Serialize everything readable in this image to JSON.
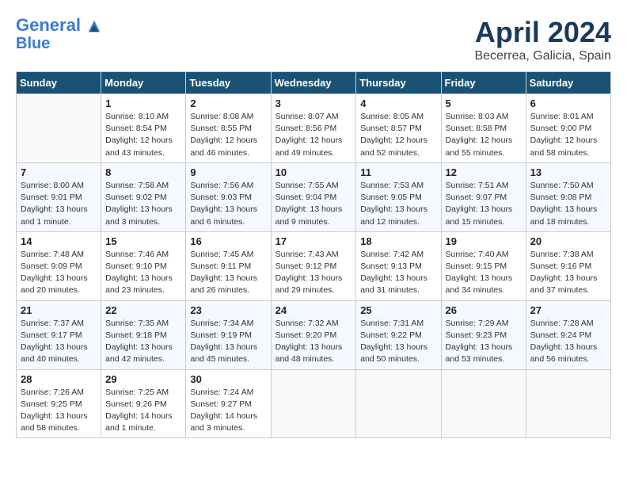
{
  "header": {
    "logo_line1": "General",
    "logo_line2": "Blue",
    "month_title": "April 2024",
    "location": "Becerrea, Galicia, Spain"
  },
  "days_of_week": [
    "Sunday",
    "Monday",
    "Tuesday",
    "Wednesday",
    "Thursday",
    "Friday",
    "Saturday"
  ],
  "weeks": [
    [
      {
        "date": "",
        "sunrise": "",
        "sunset": "",
        "daylight": ""
      },
      {
        "date": "1",
        "sunrise": "Sunrise: 8:10 AM",
        "sunset": "Sunset: 8:54 PM",
        "daylight": "Daylight: 12 hours and 43 minutes."
      },
      {
        "date": "2",
        "sunrise": "Sunrise: 8:08 AM",
        "sunset": "Sunset: 8:55 PM",
        "daylight": "Daylight: 12 hours and 46 minutes."
      },
      {
        "date": "3",
        "sunrise": "Sunrise: 8:07 AM",
        "sunset": "Sunset: 8:56 PM",
        "daylight": "Daylight: 12 hours and 49 minutes."
      },
      {
        "date": "4",
        "sunrise": "Sunrise: 8:05 AM",
        "sunset": "Sunset: 8:57 PM",
        "daylight": "Daylight: 12 hours and 52 minutes."
      },
      {
        "date": "5",
        "sunrise": "Sunrise: 8:03 AM",
        "sunset": "Sunset: 8:58 PM",
        "daylight": "Daylight: 12 hours and 55 minutes."
      },
      {
        "date": "6",
        "sunrise": "Sunrise: 8:01 AM",
        "sunset": "Sunset: 9:00 PM",
        "daylight": "Daylight: 12 hours and 58 minutes."
      }
    ],
    [
      {
        "date": "7",
        "sunrise": "Sunrise: 8:00 AM",
        "sunset": "Sunset: 9:01 PM",
        "daylight": "Daylight: 13 hours and 1 minute."
      },
      {
        "date": "8",
        "sunrise": "Sunrise: 7:58 AM",
        "sunset": "Sunset: 9:02 PM",
        "daylight": "Daylight: 13 hours and 3 minutes."
      },
      {
        "date": "9",
        "sunrise": "Sunrise: 7:56 AM",
        "sunset": "Sunset: 9:03 PM",
        "daylight": "Daylight: 13 hours and 6 minutes."
      },
      {
        "date": "10",
        "sunrise": "Sunrise: 7:55 AM",
        "sunset": "Sunset: 9:04 PM",
        "daylight": "Daylight: 13 hours and 9 minutes."
      },
      {
        "date": "11",
        "sunrise": "Sunrise: 7:53 AM",
        "sunset": "Sunset: 9:05 PM",
        "daylight": "Daylight: 13 hours and 12 minutes."
      },
      {
        "date": "12",
        "sunrise": "Sunrise: 7:51 AM",
        "sunset": "Sunset: 9:07 PM",
        "daylight": "Daylight: 13 hours and 15 minutes."
      },
      {
        "date": "13",
        "sunrise": "Sunrise: 7:50 AM",
        "sunset": "Sunset: 9:08 PM",
        "daylight": "Daylight: 13 hours and 18 minutes."
      }
    ],
    [
      {
        "date": "14",
        "sunrise": "Sunrise: 7:48 AM",
        "sunset": "Sunset: 9:09 PM",
        "daylight": "Daylight: 13 hours and 20 minutes."
      },
      {
        "date": "15",
        "sunrise": "Sunrise: 7:46 AM",
        "sunset": "Sunset: 9:10 PM",
        "daylight": "Daylight: 13 hours and 23 minutes."
      },
      {
        "date": "16",
        "sunrise": "Sunrise: 7:45 AM",
        "sunset": "Sunset: 9:11 PM",
        "daylight": "Daylight: 13 hours and 26 minutes."
      },
      {
        "date": "17",
        "sunrise": "Sunrise: 7:43 AM",
        "sunset": "Sunset: 9:12 PM",
        "daylight": "Daylight: 13 hours and 29 minutes."
      },
      {
        "date": "18",
        "sunrise": "Sunrise: 7:42 AM",
        "sunset": "Sunset: 9:13 PM",
        "daylight": "Daylight: 13 hours and 31 minutes."
      },
      {
        "date": "19",
        "sunrise": "Sunrise: 7:40 AM",
        "sunset": "Sunset: 9:15 PM",
        "daylight": "Daylight: 13 hours and 34 minutes."
      },
      {
        "date": "20",
        "sunrise": "Sunrise: 7:38 AM",
        "sunset": "Sunset: 9:16 PM",
        "daylight": "Daylight: 13 hours and 37 minutes."
      }
    ],
    [
      {
        "date": "21",
        "sunrise": "Sunrise: 7:37 AM",
        "sunset": "Sunset: 9:17 PM",
        "daylight": "Daylight: 13 hours and 40 minutes."
      },
      {
        "date": "22",
        "sunrise": "Sunrise: 7:35 AM",
        "sunset": "Sunset: 9:18 PM",
        "daylight": "Daylight: 13 hours and 42 minutes."
      },
      {
        "date": "23",
        "sunrise": "Sunrise: 7:34 AM",
        "sunset": "Sunset: 9:19 PM",
        "daylight": "Daylight: 13 hours and 45 minutes."
      },
      {
        "date": "24",
        "sunrise": "Sunrise: 7:32 AM",
        "sunset": "Sunset: 9:20 PM",
        "daylight": "Daylight: 13 hours and 48 minutes."
      },
      {
        "date": "25",
        "sunrise": "Sunrise: 7:31 AM",
        "sunset": "Sunset: 9:22 PM",
        "daylight": "Daylight: 13 hours and 50 minutes."
      },
      {
        "date": "26",
        "sunrise": "Sunrise: 7:29 AM",
        "sunset": "Sunset: 9:23 PM",
        "daylight": "Daylight: 13 hours and 53 minutes."
      },
      {
        "date": "27",
        "sunrise": "Sunrise: 7:28 AM",
        "sunset": "Sunset: 9:24 PM",
        "daylight": "Daylight: 13 hours and 56 minutes."
      }
    ],
    [
      {
        "date": "28",
        "sunrise": "Sunrise: 7:26 AM",
        "sunset": "Sunset: 9:25 PM",
        "daylight": "Daylight: 13 hours and 58 minutes."
      },
      {
        "date": "29",
        "sunrise": "Sunrise: 7:25 AM",
        "sunset": "Sunset: 9:26 PM",
        "daylight": "Daylight: 14 hours and 1 minute."
      },
      {
        "date": "30",
        "sunrise": "Sunrise: 7:24 AM",
        "sunset": "Sunset: 9:27 PM",
        "daylight": "Daylight: 14 hours and 3 minutes."
      },
      {
        "date": "",
        "sunrise": "",
        "sunset": "",
        "daylight": ""
      },
      {
        "date": "",
        "sunrise": "",
        "sunset": "",
        "daylight": ""
      },
      {
        "date": "",
        "sunrise": "",
        "sunset": "",
        "daylight": ""
      },
      {
        "date": "",
        "sunrise": "",
        "sunset": "",
        "daylight": ""
      }
    ]
  ]
}
